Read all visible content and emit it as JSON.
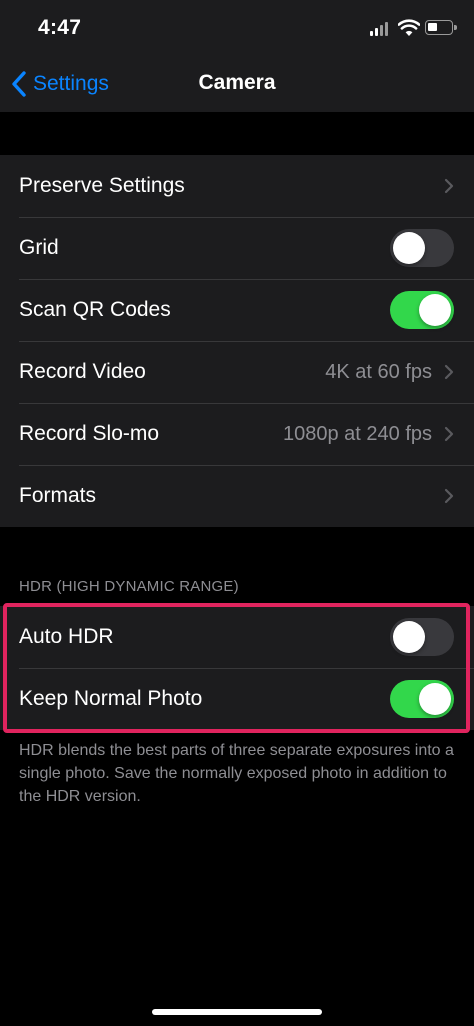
{
  "status_bar": {
    "time": "4:47",
    "icons": [
      "signal-icon",
      "wifi-icon",
      "battery-icon"
    ]
  },
  "nav": {
    "back_label": "Settings",
    "title": "Camera"
  },
  "settings": {
    "preserve": {
      "label": "Preserve Settings"
    },
    "grid": {
      "label": "Grid",
      "enabled": false
    },
    "scan_qr": {
      "label": "Scan QR Codes",
      "enabled": true
    },
    "record_video": {
      "label": "Record Video",
      "value": "4K at 60 fps"
    },
    "record_slomo": {
      "label": "Record Slo-mo",
      "value": "1080p at 240 fps"
    },
    "formats": {
      "label": "Formats"
    }
  },
  "hdr": {
    "section_header": "HDR (HIGH DYNAMIC RANGE)",
    "auto_hdr": {
      "label": "Auto HDR",
      "enabled": false
    },
    "keep_normal": {
      "label": "Keep Normal Photo",
      "enabled": true
    },
    "footer": "HDR blends the best parts of three separate exposures into a single photo. Save the normally exposed photo in addition to the HDR version."
  },
  "colors": {
    "accent": "#0a84ff",
    "toggle_on": "#32d74b",
    "toggle_off": "#39393d",
    "highlight": "#e0245e",
    "cell_background": "#1c1c1e",
    "secondary_text": "#8e8e93"
  }
}
